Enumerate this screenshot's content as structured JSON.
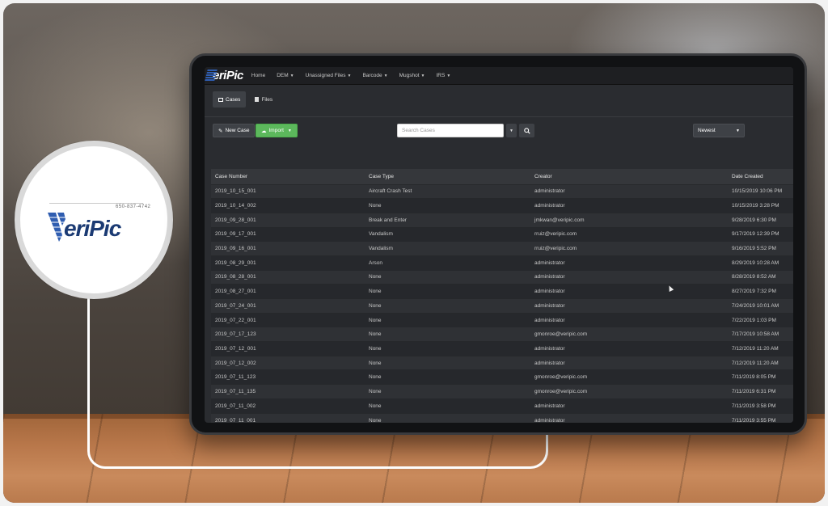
{
  "logo": {
    "text": "VeriPic",
    "phone": "650-837-4742"
  },
  "app": {
    "brand": "eriPic",
    "nav": [
      {
        "label": "Home",
        "dropdown": false
      },
      {
        "label": "DEM",
        "dropdown": true
      },
      {
        "label": "Unassigned Files",
        "dropdown": true
      },
      {
        "label": "Barcode",
        "dropdown": true
      },
      {
        "label": "Mugshot",
        "dropdown": true
      },
      {
        "label": "IRS",
        "dropdown": true
      }
    ],
    "tabs": [
      {
        "label": "Cases",
        "active": true,
        "icon": "cases-icon"
      },
      {
        "label": "Files",
        "active": false,
        "icon": "file-icon"
      }
    ],
    "toolbar": {
      "new_case": "New Case",
      "import": "Import",
      "search_placeholder": "Search Cases",
      "sort_selected": "Newest"
    },
    "table": {
      "headers": [
        "Case Number",
        "Case Type",
        "Creator",
        "Date Created"
      ],
      "rows": [
        [
          "2019_10_15_001",
          "Aircraft Crash Test",
          "administrator",
          "10/15/2019 10:06 PM"
        ],
        [
          "2019_10_14_002",
          "None",
          "administrator",
          "10/15/2019 3:28 PM"
        ],
        [
          "2019_09_28_001",
          "Break and Enter",
          "jmkwan@veripic.com",
          "9/28/2019 6:30 PM"
        ],
        [
          "2019_09_17_001",
          "Vandalism",
          "rruiz@veripic.com",
          "9/17/2019 12:39 PM"
        ],
        [
          "2019_09_16_001",
          "Vandalism",
          "rruiz@veripic.com",
          "9/16/2019 5:52 PM"
        ],
        [
          "2019_08_29_001",
          "Arson",
          "administrator",
          "8/29/2019 10:28 AM"
        ],
        [
          "2019_08_28_001",
          "None",
          "administrator",
          "8/28/2019 8:52 AM"
        ],
        [
          "2019_08_27_001",
          "None",
          "administrator",
          "8/27/2019 7:32 PM"
        ],
        [
          "2019_07_24_001",
          "None",
          "administrator",
          "7/24/2019 10:01 AM"
        ],
        [
          "2019_07_22_001",
          "None",
          "administrator",
          "7/22/2019 1:03 PM"
        ],
        [
          "2019_07_17_123",
          "None",
          "gmonroe@veripic.com",
          "7/17/2019 10:58 AM"
        ],
        [
          "2019_07_12_001",
          "None",
          "administrator",
          "7/12/2019 11:20 AM"
        ],
        [
          "2019_07_12_002",
          "None",
          "administrator",
          "7/12/2019 11:20 AM"
        ],
        [
          "2019_07_11_123",
          "None",
          "gmonroe@veripic.com",
          "7/11/2019 8:05 PM"
        ],
        [
          "2019_07_11_135",
          "None",
          "gmonroe@veripic.com",
          "7/11/2019 6:31 PM"
        ],
        [
          "2019_07_11_002",
          "None",
          "administrator",
          "7/11/2019 3:58 PM"
        ],
        [
          "2019_07_11_001",
          "None",
          "administrator",
          "7/11/2019 3:55 PM"
        ]
      ]
    }
  }
}
